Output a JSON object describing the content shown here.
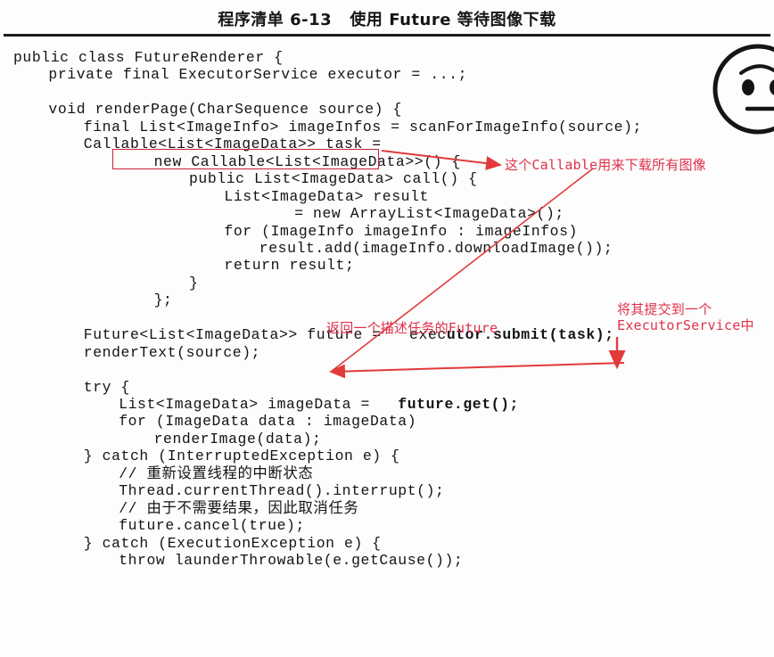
{
  "header": {
    "listing_title": "程序清单 6-13   使用 Future 等待图像下载"
  },
  "code": {
    "language": "java",
    "lines": [
      {
        "indent": 0,
        "text": "public class FutureRenderer {"
      },
      {
        "indent": 1,
        "text": "private final ExecutorService executor = ...;"
      },
      {
        "indent": 0,
        "text": ""
      },
      {
        "indent": 1,
        "text": "void renderPage(CharSequence source) {"
      },
      {
        "indent": 2,
        "text": "final List<ImageInfo> imageInfos = scanForImageInfo(source);"
      },
      {
        "indent": 2,
        "text": "Callable<List<ImageData>> task ="
      },
      {
        "indent": 4,
        "text": "new Callable<List<ImageData>>() {"
      },
      {
        "indent": 5,
        "text": "public List<ImageData> call() {"
      },
      {
        "indent": 6,
        "text": "List<ImageData> result"
      },
      {
        "indent": 8,
        "text": "= new ArrayList<ImageData>();"
      },
      {
        "indent": 6,
        "text": "for (ImageInfo imageInfo : imageInfos)"
      },
      {
        "indent": 7,
        "text": "result.add(imageInfo.downloadImage());"
      },
      {
        "indent": 6,
        "text": "return result;"
      },
      {
        "indent": 5,
        "text": "}"
      },
      {
        "indent": 4,
        "text": "};"
      },
      {
        "indent": 0,
        "text": ""
      },
      {
        "indent": 2,
        "text": "Future<List<ImageData>> future =   executor.submit(task);",
        "bold_from": 39
      },
      {
        "indent": 2,
        "text": "renderText(source);"
      },
      {
        "indent": 0,
        "text": ""
      },
      {
        "indent": 2,
        "text": "try {"
      },
      {
        "indent": 3,
        "text": "List<ImageData> imageData =   future.get();",
        "bold_from": 30
      },
      {
        "indent": 3,
        "text": "for (ImageData data : imageData)"
      },
      {
        "indent": 4,
        "text": "renderImage(data);"
      },
      {
        "indent": 2,
        "text": "} catch (InterruptedException e) {"
      },
      {
        "indent": 3,
        "text": "// 重新设置线程的中断状态"
      },
      {
        "indent": 3,
        "text": "Thread.currentThread().interrupt();"
      },
      {
        "indent": 3,
        "text": "// 由于不需要结果，因此取消任务"
      },
      {
        "indent": 3,
        "text": "future.cancel(true);"
      },
      {
        "indent": 2,
        "text": "} catch (ExecutionException e) {"
      },
      {
        "indent": 3,
        "text": "throw launderThrowable(e.getCause());"
      }
    ]
  },
  "annotations": {
    "callable_note": "这个Callable用来下载所有图像",
    "submit_note": "将其提交到一个\nExecutorService中",
    "future_note": "返回一个描述任务的Future"
  },
  "colors": {
    "annotation_red": "#e0304a",
    "box_red": "#cc1f35",
    "arrow_red": "#e23a3a",
    "code_black": "#141414",
    "page_background": "#fdfdfd"
  },
  "doodle": {
    "name": "cartoon-face",
    "description": "hand drawn round face with two eyes, one eyebrow and a flat mouth"
  }
}
